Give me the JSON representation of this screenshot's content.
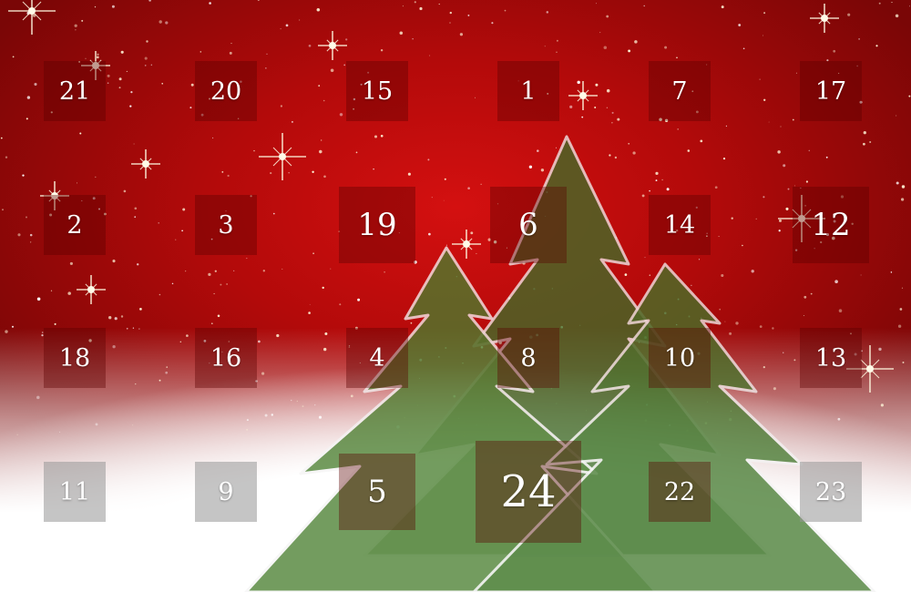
{
  "calendar": {
    "doors": [
      {
        "label": "21",
        "row": 1,
        "col": 1,
        "size": "s",
        "tone": "dark"
      },
      {
        "label": "20",
        "row": 1,
        "col": 2,
        "size": "s",
        "tone": "dark"
      },
      {
        "label": "15",
        "row": 1,
        "col": 3,
        "size": "s",
        "tone": "dark"
      },
      {
        "label": "1",
        "row": 1,
        "col": 4,
        "size": "s",
        "tone": "dark"
      },
      {
        "label": "7",
        "row": 1,
        "col": 5,
        "size": "s",
        "tone": "dark"
      },
      {
        "label": "17",
        "row": 1,
        "col": 6,
        "size": "s",
        "tone": "dark"
      },
      {
        "label": "2",
        "row": 2,
        "col": 1,
        "size": "s",
        "tone": "dark"
      },
      {
        "label": "3",
        "row": 2,
        "col": 2,
        "size": "s",
        "tone": "dark"
      },
      {
        "label": "19",
        "row": 2,
        "col": 3,
        "size": "m",
        "tone": "dark"
      },
      {
        "label": "6",
        "row": 2,
        "col": 4,
        "size": "m",
        "tone": "dark"
      },
      {
        "label": "14",
        "row": 2,
        "col": 5,
        "size": "s",
        "tone": "dark"
      },
      {
        "label": "12",
        "row": 2,
        "col": 6,
        "size": "m",
        "tone": "dark"
      },
      {
        "label": "18",
        "row": 3,
        "col": 1,
        "size": "s",
        "tone": "dark"
      },
      {
        "label": "16",
        "row": 3,
        "col": 2,
        "size": "s",
        "tone": "dark"
      },
      {
        "label": "4",
        "row": 3,
        "col": 3,
        "size": "s",
        "tone": "dark"
      },
      {
        "label": "8",
        "row": 3,
        "col": 4,
        "size": "s",
        "tone": "dark"
      },
      {
        "label": "10",
        "row": 3,
        "col": 5,
        "size": "s",
        "tone": "dark"
      },
      {
        "label": "13",
        "row": 3,
        "col": 6,
        "size": "s",
        "tone": "dark"
      },
      {
        "label": "11",
        "row": 4,
        "col": 1,
        "size": "s",
        "tone": "light"
      },
      {
        "label": "9",
        "row": 4,
        "col": 2,
        "size": "s",
        "tone": "light"
      },
      {
        "label": "5",
        "row": 4,
        "col": 3,
        "size": "m",
        "tone": "dark"
      },
      {
        "label": "24",
        "row": 4,
        "col": 4,
        "size": "l",
        "tone": "dark"
      },
      {
        "label": "22",
        "row": 4,
        "col": 5,
        "size": "s",
        "tone": "dark"
      },
      {
        "label": "23",
        "row": 4,
        "col": 6,
        "size": "s",
        "tone": "light"
      }
    ]
  },
  "colors": {
    "background": "#b30a0a",
    "tree": "#3d7a2e",
    "snow": "#ffffff",
    "door_text": "#ffffff"
  },
  "icons": [
    "star-sparkle-icon",
    "christmas-tree-icon"
  ]
}
